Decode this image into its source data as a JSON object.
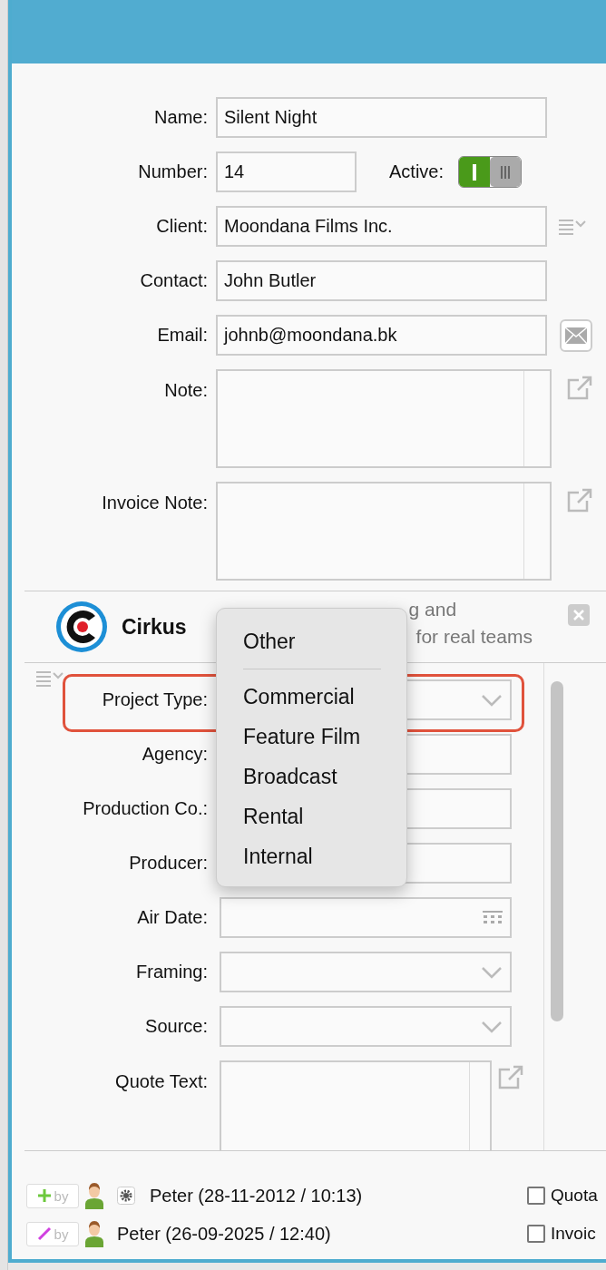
{
  "form": {
    "name": {
      "label": "Name:",
      "value": "Silent Night"
    },
    "number": {
      "label": "Number:",
      "value": "14"
    },
    "active": {
      "label": "Active:",
      "on": true
    },
    "client": {
      "label": "Client:",
      "value": "Moondana Films Inc."
    },
    "contact": {
      "label": "Contact:",
      "value": "John Butler"
    },
    "email": {
      "label": "Email:",
      "value": "johnb@moondana.bk"
    },
    "note": {
      "label": "Note:"
    },
    "invoice_note": {
      "label": "Invoice Note:"
    }
  },
  "banner": {
    "name": "Cirkus",
    "tagline": [
      "g and",
      "for real teams"
    ]
  },
  "project_fields": [
    {
      "label": "Project Type:",
      "kind": "select",
      "highlighted": true
    },
    {
      "label": "Agency:",
      "kind": "text",
      "highlighted": false
    },
    {
      "label": "Production Co.:",
      "kind": "text",
      "highlighted": false
    },
    {
      "label": "Producer:",
      "kind": "text",
      "highlighted": false
    },
    {
      "label": "Air Date:",
      "kind": "date",
      "highlighted": false
    },
    {
      "label": "Framing:",
      "kind": "select",
      "highlighted": false
    },
    {
      "label": "Source:",
      "kind": "select",
      "highlighted": false
    },
    {
      "label": "Quote Text:",
      "kind": "textarea",
      "highlighted": false
    }
  ],
  "menu": {
    "items": [
      {
        "kind": "item",
        "label": "Other"
      },
      {
        "kind": "separator"
      },
      {
        "kind": "item",
        "label": "Commercial"
      },
      {
        "kind": "item",
        "label": "Feature Film"
      },
      {
        "kind": "item",
        "label": "Broadcast"
      },
      {
        "kind": "item",
        "label": "Rental"
      },
      {
        "kind": "item",
        "label": "Internal"
      }
    ]
  },
  "footer": {
    "created": {
      "badge": "by",
      "text": "Peter (28-11-2012 / 10:13)"
    },
    "modified": {
      "badge": "by",
      "text": "Peter (26-09-2025 / 12:40)"
    },
    "checkboxes": [
      {
        "label": "Quota",
        "checked": false
      },
      {
        "label": "Invoic",
        "checked": false
      }
    ]
  }
}
